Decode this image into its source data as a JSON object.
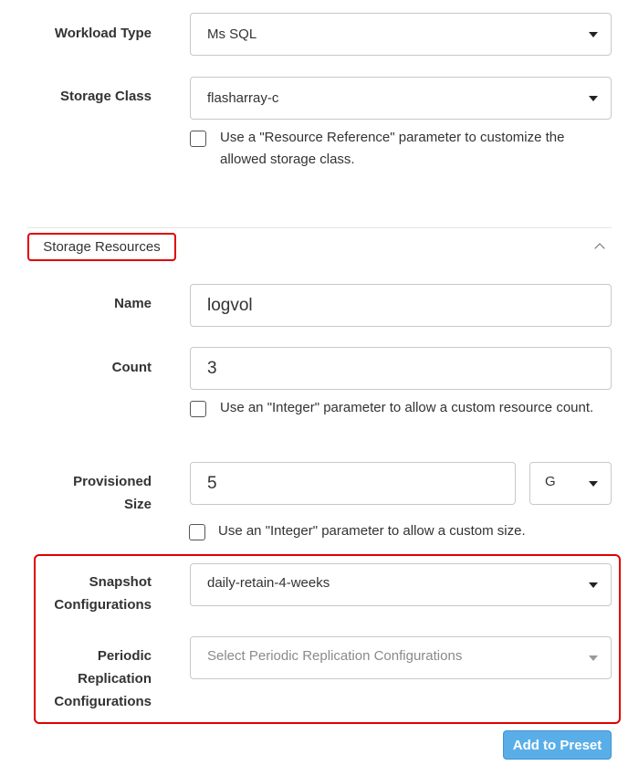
{
  "workload_type": {
    "label": "Workload Type",
    "value": "Ms SQL"
  },
  "storage_class": {
    "label": "Storage Class",
    "value": "flasharray-c",
    "checkbox_text": "Use a \"Resource Reference\" parameter to customize the allowed storage class."
  },
  "storage_resources": {
    "title": "Storage Resources",
    "name": {
      "label": "Name",
      "value": "logvol"
    },
    "count": {
      "label": "Count",
      "value": "3",
      "checkbox_text": "Use an \"Integer\" parameter to allow a custom resource count."
    },
    "provisioned_size": {
      "label_line1": "Provisioned",
      "label_line2": "Size",
      "value": "5",
      "unit": "G",
      "checkbox_text": "Use an \"Integer\" parameter to allow a custom size."
    },
    "snapshot": {
      "label_line1": "Snapshot",
      "label_line2": "Configurations",
      "value": "daily-retain-4-weeks"
    },
    "replication": {
      "label_line1": "Periodic",
      "label_line2": "Replication",
      "label_line3": "Configurations",
      "placeholder": "Select Periodic Replication Configurations"
    }
  },
  "add_button": "Add to Preset",
  "colors": {
    "highlight_red": "#e00000",
    "button_blue": "#5aaee8",
    "border_gray": "#c8c8c8"
  }
}
